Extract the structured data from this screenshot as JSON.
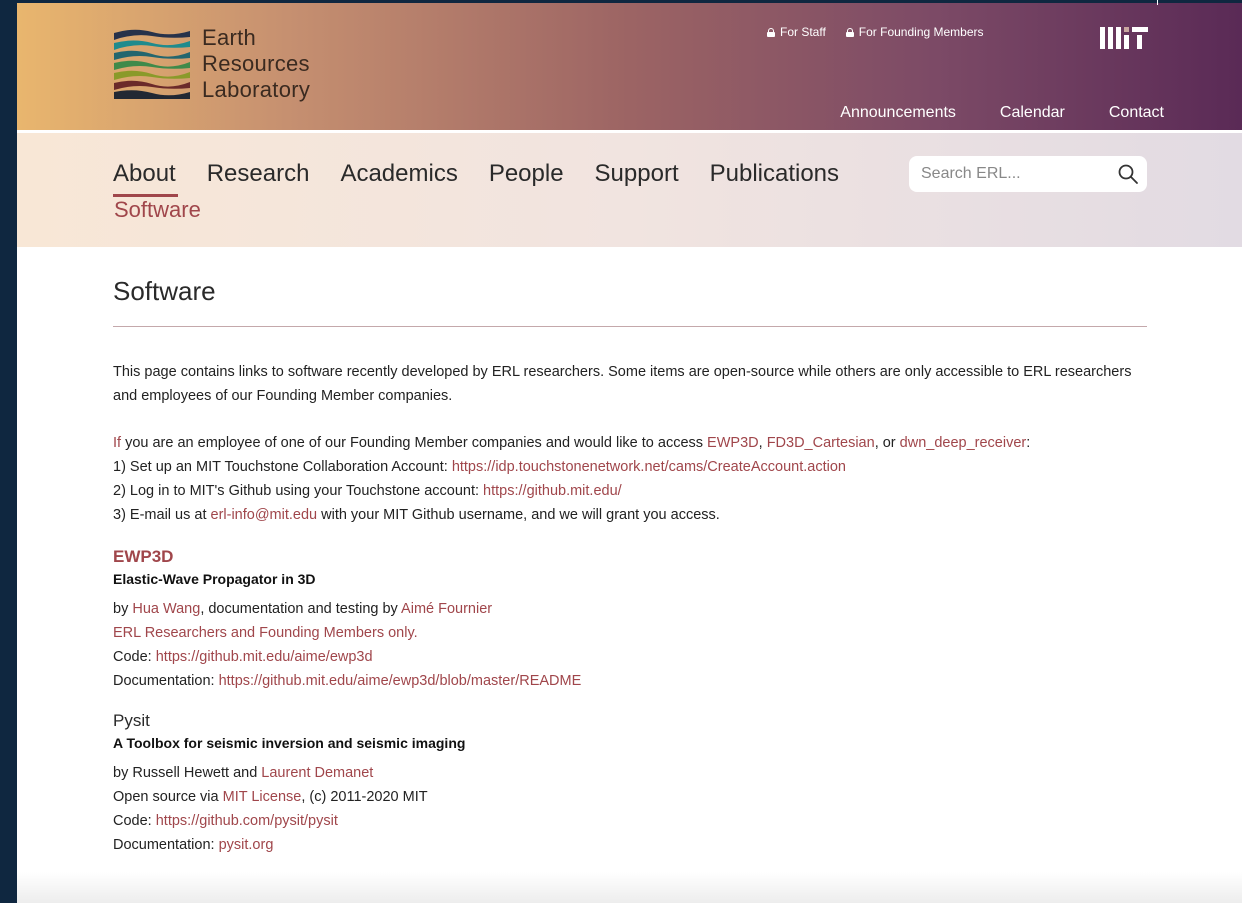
{
  "header": {
    "logo_lines": [
      "Earth",
      "Resources",
      "Laboratory"
    ],
    "utility_links": [
      "For Staff",
      "For Founding Members"
    ],
    "secondary_nav": [
      "Announcements",
      "Calendar",
      "Contact"
    ]
  },
  "nav": {
    "items": [
      "About",
      "Research",
      "Academics",
      "People",
      "Support",
      "Publications"
    ],
    "active": "About",
    "sub_item": "Software"
  },
  "search": {
    "placeholder": "Search ERL..."
  },
  "page": {
    "title": "Software",
    "intro_text": "This page contains links to software recently developed by ERL researchers. Some items are open-source while others are only accessible to ERL researchers and employees of our Founding Member companies.",
    "access": {
      "if_word": "If",
      "lead": " you are an employee of one of our Founding Member companies and would like to access ",
      "link1": "EWP3D",
      "sep1": ", ",
      "link2": "FD3D_Cartesian",
      "sep2": ", or ",
      "link3": "dwn_deep_receiver",
      "end": ":",
      "step1_text": "1) Set up an MIT Touchstone Collaboration Account: ",
      "step1_link": "https://idp.touchstonenetwork.net/cams/CreateAccount.action",
      "step2_text": "2) Log in to MIT's Github using your Touchstone account: ",
      "step2_link": "https://github.mit.edu/",
      "step3_pre": "3) E-mail us at ",
      "step3_link": "erl-info@mit.edu",
      "step3_post": " with your MIT Github username, and we will grant you access."
    }
  },
  "software": [
    {
      "name": "EWP3D",
      "subtitle": "Elastic-Wave Propagator in 3D",
      "by_pre": "by ",
      "author1": "Hua Wang",
      "by_mid": ", documentation and testing by ",
      "author2": "Aimé Fournier",
      "access_note": "ERL Researchers and Founding Members only.",
      "code_label": "Code: ",
      "code_link": "https://github.mit.edu/aime/ewp3d",
      "doc_label": "Documentation: ",
      "doc_link": "https://github.mit.edu/aime/ewp3d/blob/master/README"
    },
    {
      "name": "Pysit",
      "subtitle": "A Toolbox for seismic inversion and seismic imaging",
      "by_pre": "by Russell Hewett and ",
      "author1": "Laurent Demanet",
      "license_pre": "Open source via ",
      "license_link": "MIT License",
      "license_post": ", (c) 2011-2020 MIT",
      "code_label": "Code: ",
      "code_link": "https://github.com/pysit/pysit",
      "doc_label": "Documentation: ",
      "doc_link": "pysit.org"
    }
  ],
  "colors": {
    "accent": "#a0464b",
    "header_left": "#e9b66e",
    "header_right": "#5a2a56",
    "frame": "#0f2740"
  }
}
